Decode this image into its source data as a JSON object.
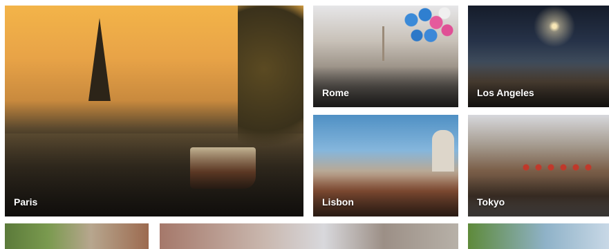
{
  "destinations": {
    "paris": {
      "label": "Paris"
    },
    "rome": {
      "label": "Rome"
    },
    "los_angeles": {
      "label": "Los Angeles"
    },
    "lisbon": {
      "label": "Lisbon"
    },
    "tokyo": {
      "label": "Tokyo"
    }
  },
  "colors": {
    "label_text": "#ffffff",
    "page_background": "#ffffff"
  }
}
